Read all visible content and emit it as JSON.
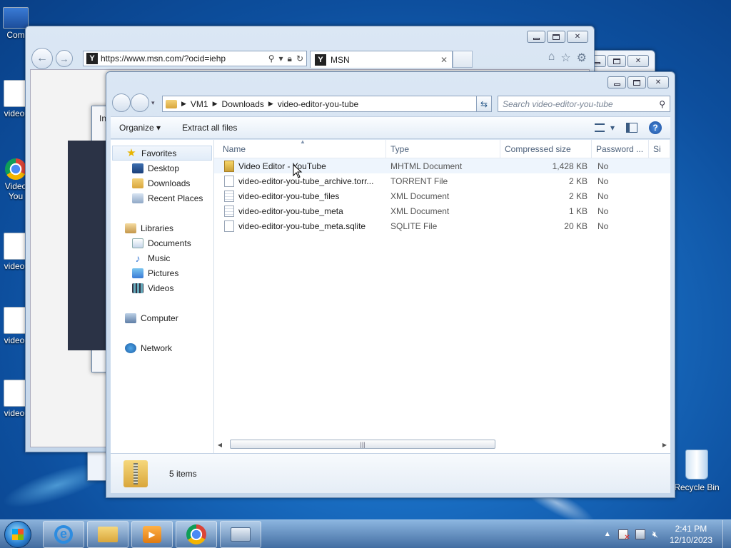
{
  "desktop": {
    "icons": [
      {
        "label": "Com"
      },
      {
        "label": "video-"
      },
      {
        "label": "Video"
      },
      {
        "label": "You"
      },
      {
        "label": "video-"
      },
      {
        "label": "video-"
      },
      {
        "label": "video-"
      }
    ],
    "recycle_bin": "Recycle Bin"
  },
  "ie": {
    "url": "https://www.msn.com/?ocid=iehp",
    "tab_title": "MSN",
    "logo_letter": "Y"
  },
  "back_window": {
    "fragment": "In"
  },
  "explorer": {
    "breadcrumb": [
      "VM1",
      "Downloads",
      "video-editor-you-tube"
    ],
    "search_placeholder": "Search video-editor-you-tube",
    "toolbar": {
      "organize": "Organize",
      "extract": "Extract all files"
    },
    "sidebar": {
      "favorites": "Favorites",
      "favorites_items": [
        "Desktop",
        "Downloads",
        "Recent Places"
      ],
      "libraries": "Libraries",
      "libraries_items": [
        "Documents",
        "Music",
        "Pictures",
        "Videos"
      ],
      "computer": "Computer",
      "network": "Network"
    },
    "columns": [
      "Name",
      "Type",
      "Compressed size",
      "Password ...",
      "Si"
    ],
    "files": [
      {
        "name": "Video Editor - YouTube",
        "type": "MHTML Document",
        "size": "1,428 KB",
        "password": "No",
        "icon": "mhtml-icon"
      },
      {
        "name": "video-editor-you-tube_archive.torr...",
        "type": "TORRENT File",
        "size": "2 KB",
        "password": "No",
        "icon": "file-icon"
      },
      {
        "name": "video-editor-you-tube_files",
        "type": "XML Document",
        "size": "2 KB",
        "password": "No",
        "icon": "xml-icon"
      },
      {
        "name": "video-editor-you-tube_meta",
        "type": "XML Document",
        "size": "1 KB",
        "password": "No",
        "icon": "xml-icon"
      },
      {
        "name": "video-editor-you-tube_meta.sqlite",
        "type": "SQLITE File",
        "size": "20 KB",
        "password": "No",
        "icon": "file-icon"
      }
    ],
    "status": "5 items"
  },
  "taskbar": {
    "time": "2:41 PM",
    "date": "12/10/2023"
  }
}
